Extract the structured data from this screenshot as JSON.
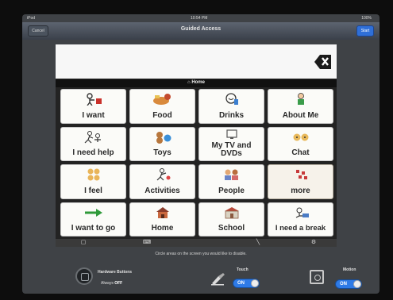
{
  "status_bar": {
    "carrier": "iPod",
    "time": "10:54 PM",
    "battery": "100%"
  },
  "nav": {
    "title": "Guided Access",
    "cancel_label": "Cancel",
    "start_label": "Start"
  },
  "app": {
    "page_label": "Home",
    "tiles": [
      {
        "label": "I want",
        "icon": "i-want-icon"
      },
      {
        "label": "Food",
        "icon": "food-icon"
      },
      {
        "label": "Drinks",
        "icon": "drinks-icon"
      },
      {
        "label": "About Me",
        "icon": "about-me-icon"
      },
      {
        "label": "I need help",
        "icon": "help-icon"
      },
      {
        "label": "Toys",
        "icon": "toys-icon"
      },
      {
        "label": "My TV and DVDs",
        "icon": "tv-icon"
      },
      {
        "label": "Chat",
        "icon": "chat-icon"
      },
      {
        "label": "I feel",
        "icon": "feel-icon"
      },
      {
        "label": "Activities",
        "icon": "activities-icon"
      },
      {
        "label": "People",
        "icon": "people-icon"
      },
      {
        "label": "more",
        "icon": "more-icon"
      },
      {
        "label": "I want to go",
        "icon": "arrow-right-icon"
      },
      {
        "label": "Home",
        "icon": "house-icon"
      },
      {
        "label": "School",
        "icon": "school-icon"
      },
      {
        "label": "I need a break",
        "icon": "break-icon"
      }
    ]
  },
  "guided_access": {
    "instruction": "Circle areas on the screen you would like to disable.",
    "hardware_buttons_label": "Hardware Buttons",
    "hardware_buttons_prefix": "Always",
    "hardware_buttons_value": "OFF",
    "touch_label": "Touch",
    "touch_value": "ON",
    "motion_label": "Motion",
    "motion_value": "ON"
  },
  "colors": {
    "accent": "#2e7ae6",
    "tile_bg": "#fbfbf8",
    "frame_bg": "#3f4246"
  }
}
